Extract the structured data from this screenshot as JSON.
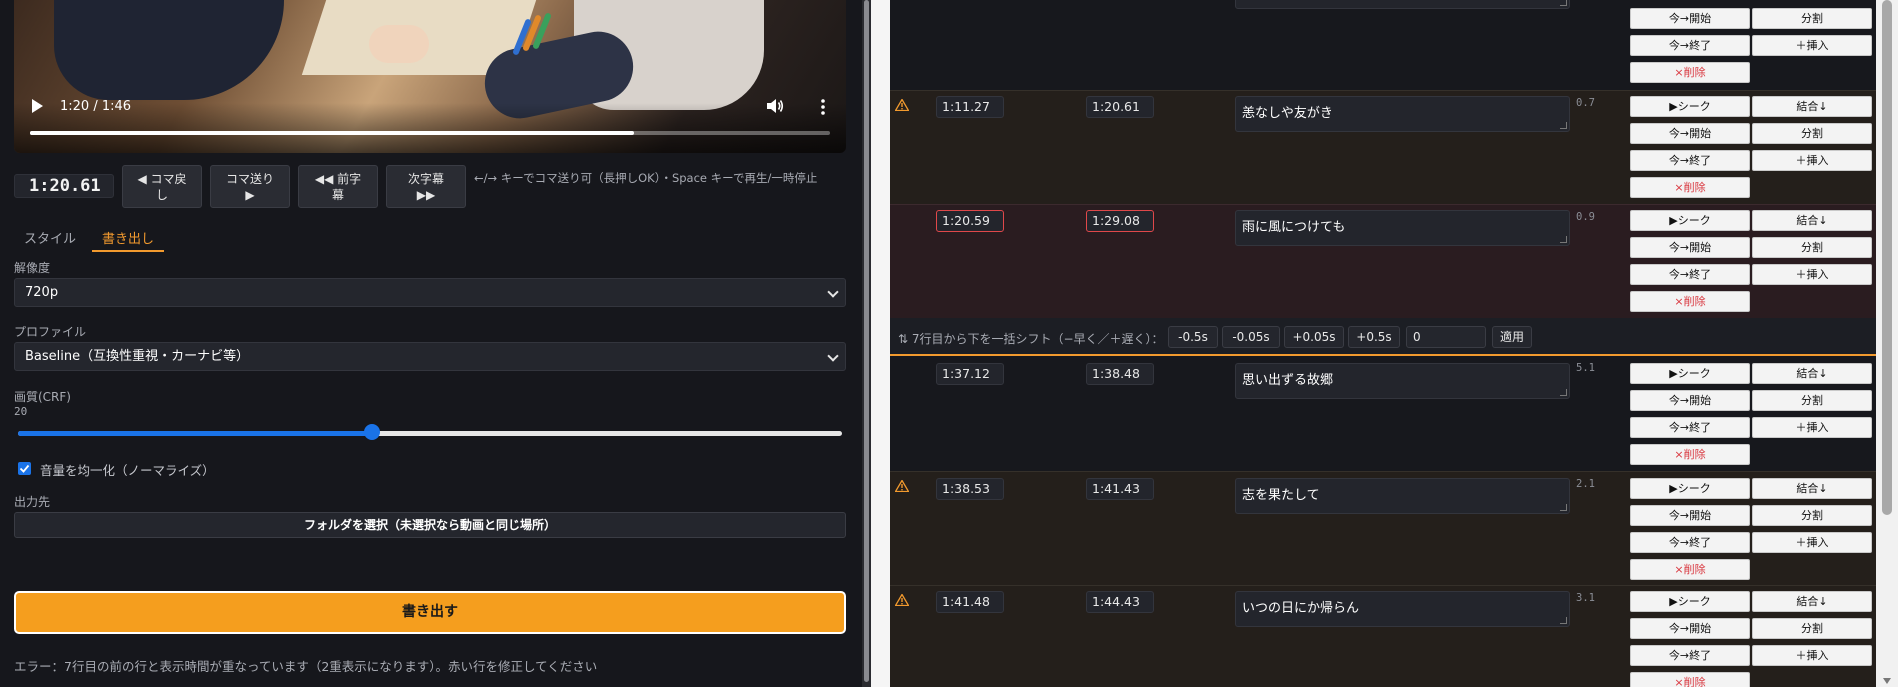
{
  "video": {
    "time": "1:20 / 1:46",
    "current_seconds": 80,
    "duration_seconds": 106,
    "buffered_fraction": 0.69
  },
  "transport": {
    "timecode": "1:20.61",
    "buttons": [
      {
        "line1": "◀ コマ戻",
        "line2": "し"
      },
      {
        "line1": "コマ送り",
        "line2": "▶"
      },
      {
        "line1": "◀◀ 前字",
        "line2": "幕"
      },
      {
        "line1": "次字幕",
        "line2": "▶▶"
      }
    ],
    "hint": "←/→ キーでコマ送り可（長押しOK）・Space キーで再生/一時停止"
  },
  "tabs": [
    {
      "label": "スタイル",
      "active": false
    },
    {
      "label": "書き出し",
      "active": true
    }
  ],
  "export": {
    "resolution_label": "解像度",
    "resolution_value": "720p",
    "profile_label": "プロファイル",
    "profile_value": "Baseline（互換性重視・カーナビ等）",
    "quality_label": "画質(CRF)",
    "quality_value": "20",
    "quality_fraction": 0.43,
    "normalize_label": "音量を均一化（ノーマライズ）",
    "normalize_checked": true,
    "output_label": "出力先",
    "folder_button": "フォルダを選択（未選択なら動画と同じ場所）",
    "export_button": "書き出す",
    "error": "エラー：7行目の前の行と表示時間が重なっています（2重表示になります）。赤い行を修正してください"
  },
  "subtitle_rows": [
    {
      "start": "",
      "end": "",
      "text": "",
      "dur": "",
      "status": "plain"
    },
    {
      "start": "1:11.27",
      "end": "1:20.61",
      "text": "恙なしや友がき",
      "dur": "0.7",
      "status": "warn"
    },
    {
      "start": "1:20.59",
      "end": "1:29.08",
      "text": "雨に風につけても",
      "dur": "0.9",
      "status": "err"
    },
    {
      "start": "1:37.12",
      "end": "1:38.48",
      "text": "思い出ずる故郷",
      "dur": "5.1",
      "status": "plain"
    },
    {
      "start": "1:38.53",
      "end": "1:41.43",
      "text": "志を果たして",
      "dur": "2.1",
      "status": "warn"
    },
    {
      "start": "1:41.48",
      "end": "1:44.43",
      "text": "いつの日にか帰らん",
      "dur": "3.1",
      "status": "warn"
    }
  ],
  "row_buttons": {
    "seek": "▶シーク",
    "set_start": "今→開始",
    "set_end": "今→終了",
    "delete": "×削除",
    "merge": "結合↓",
    "split": "分割",
    "insert": "＋挿入"
  },
  "shift_bar": {
    "label": "⇅ 7行目から下を一括シフト（−早く／＋遅く）：",
    "buttons": [
      "-0.5s",
      "-0.05s",
      "+0.05s",
      "+0.5s"
    ],
    "input_value": "0",
    "apply": "適用"
  },
  "colors": {
    "accent": "#f59e1e",
    "link_blue": "#1a73e8",
    "error_red": "#e0484a",
    "warn_orange": "#f29a2e"
  }
}
